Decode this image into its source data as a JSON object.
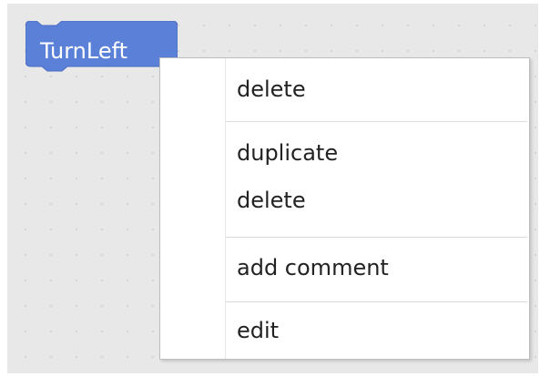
{
  "workspace": {
    "background_color": "#e8e8e8"
  },
  "block": {
    "label": "TurnLeft",
    "color": "#5b80d8"
  },
  "context_menu": {
    "items": [
      {
        "label": "delete"
      },
      {
        "label": "duplicate"
      },
      {
        "label": "delete"
      },
      {
        "label": "add comment"
      },
      {
        "label": "edit"
      }
    ]
  }
}
